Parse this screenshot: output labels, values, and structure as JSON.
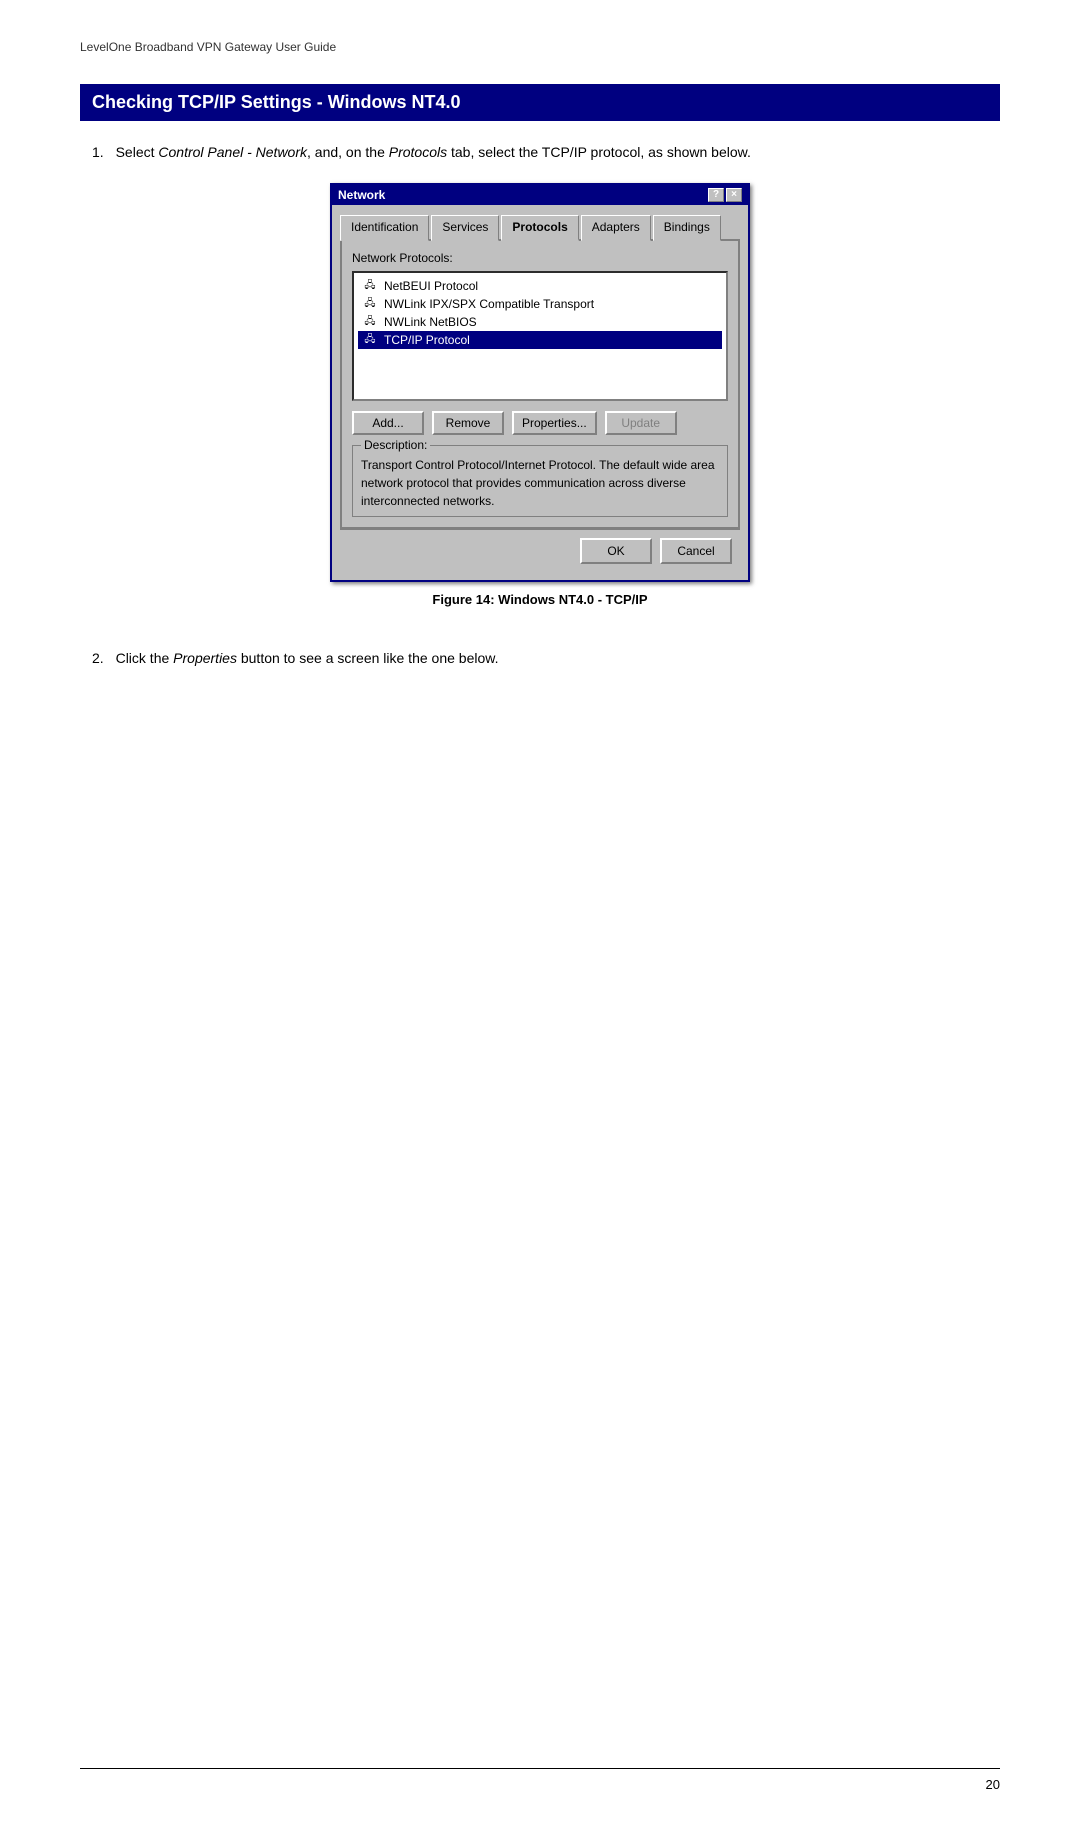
{
  "header": {
    "text": "LevelOne Broadband VPN Gateway User Guide"
  },
  "section": {
    "title": "Checking TCP/IP Settings - Windows NT4.0"
  },
  "step1": {
    "number": "1.",
    "text_before1": "Select ",
    "italic1": "Control Panel - Network",
    "text_middle1": ", and, on the ",
    "italic2": "Protocols",
    "text_after1": " tab, select the TCP/IP protocol, as shown below."
  },
  "dialog": {
    "title": "Network",
    "help_btn": "?",
    "close_btn": "×",
    "tabs": [
      {
        "label": "Identification",
        "active": false
      },
      {
        "label": "Services",
        "active": false
      },
      {
        "label": "Protocols",
        "active": true
      },
      {
        "label": "Adapters",
        "active": false
      },
      {
        "label": "Bindings",
        "active": false
      }
    ],
    "group_label": "Network Protocols:",
    "protocols": [
      {
        "name": "NetBEUI Protocol",
        "selected": false
      },
      {
        "name": "NWLink IPX/SPX Compatible Transport",
        "selected": false
      },
      {
        "name": "NWLink NetBIOS",
        "selected": false
      },
      {
        "name": "TCP/IP Protocol",
        "selected": true
      }
    ],
    "buttons": [
      {
        "label": "Add...",
        "disabled": false
      },
      {
        "label": "Remove",
        "disabled": false
      },
      {
        "label": "Properties...",
        "disabled": false
      },
      {
        "label": "Update",
        "disabled": true
      }
    ],
    "description_label": "Description:",
    "description_text": "Transport Control Protocol/Internet Protocol. The default wide area network protocol that provides communication across diverse interconnected networks.",
    "ok_label": "OK",
    "cancel_label": "Cancel"
  },
  "figure_caption": "Figure 14: Windows NT4.0 - TCP/IP",
  "step2": {
    "number": "2.",
    "text_before": "Click the ",
    "italic": "Properties",
    "text_after": " button to see a screen like the one below."
  },
  "footer": {
    "page_number": "20"
  }
}
